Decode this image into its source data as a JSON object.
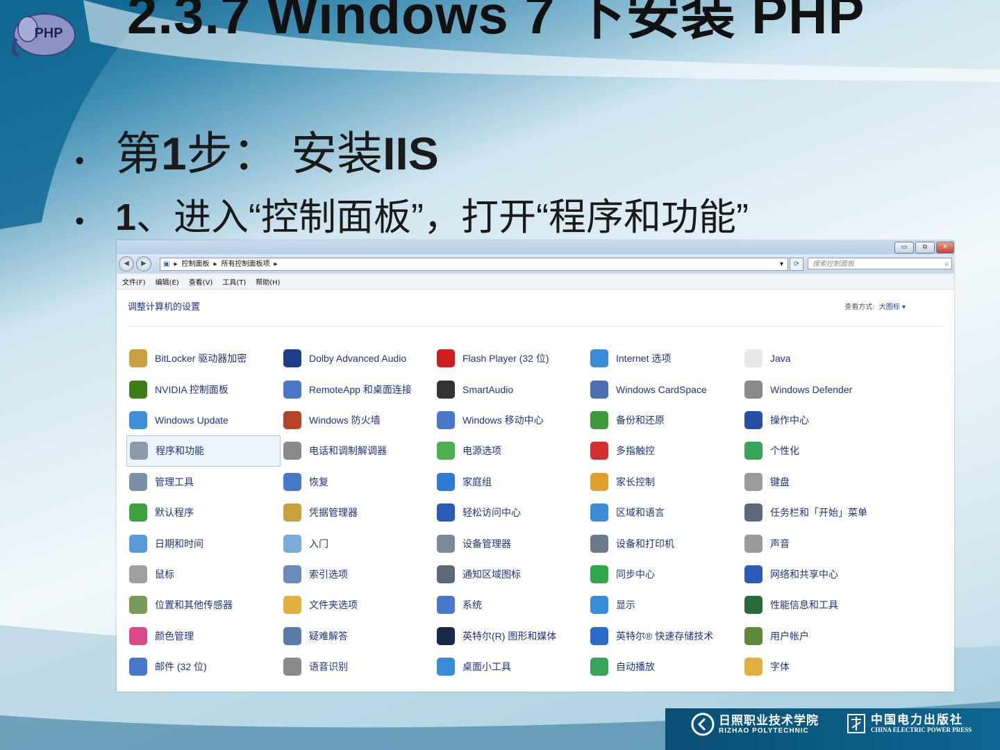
{
  "slide": {
    "title": "2.3.7 Windows 7 下安装 PHP",
    "bullet1_prefix": "第 ",
    "bullet1_num": "1",
    "bullet1_text": " 步：  安装 ",
    "bullet1_bold": "IIS",
    "bullet2_num": "1",
    "bullet2_text": " 、进入“控制面板”，打开“程序和功能”",
    "logo_text": "PHP"
  },
  "window": {
    "breadcrumb": [
      "控制面板",
      "所有控制面板项"
    ],
    "search_placeholder": "搜索控制面板",
    "menu": [
      "文件(F)",
      "编辑(E)",
      "查看(V)",
      "工具(T)",
      "帮助(H)"
    ],
    "heading": "调整计算机的设置",
    "view_by_label": "查看方式:",
    "view_by_value": "大图标 ▾",
    "items": [
      {
        "label": "BitLocker 驱动器加密",
        "icon": "bitlocker-icon",
        "color": "#c9a040"
      },
      {
        "label": "Dolby Advanced Audio",
        "icon": "dolby-icon",
        "color": "#1d3f8a"
      },
      {
        "label": "Flash Player (32 位)",
        "icon": "flash-icon",
        "color": "#d21d1d"
      },
      {
        "label": "Internet 选项",
        "icon": "internet-options-icon",
        "color": "#3a8cd8"
      },
      {
        "label": "Java",
        "icon": "java-icon",
        "color": "#e8e8e8"
      },
      {
        "label": "NVIDIA 控制面板",
        "icon": "nvidia-icon",
        "color": "#3c7d1a"
      },
      {
        "label": "RemoteApp 和桌面连接",
        "icon": "remoteapp-icon",
        "color": "#4a78c8"
      },
      {
        "label": "SmartAudio",
        "icon": "smartaudio-icon",
        "color": "#333333"
      },
      {
        "label": "Windows CardSpace",
        "icon": "cardspace-icon",
        "color": "#4a6fb0"
      },
      {
        "label": "Windows Defender",
        "icon": "defender-icon",
        "color": "#8a8a8a"
      },
      {
        "label": "Windows Update",
        "icon": "windows-update-icon",
        "color": "#3d8fd8"
      },
      {
        "label": "Windows 防火墙",
        "icon": "firewall-icon",
        "color": "#b5452a"
      },
      {
        "label": "Windows 移动中心",
        "icon": "mobility-center-icon",
        "color": "#4a78c8"
      },
      {
        "label": "备份和还原",
        "icon": "backup-icon",
        "color": "#3a9a3a"
      },
      {
        "label": "操作中心",
        "icon": "action-center-icon",
        "color": "#2a4ea8"
      },
      {
        "label": "程序和功能",
        "icon": "programs-features-icon",
        "color": "#8d9aa8"
      },
      {
        "label": "电话和调制解调器",
        "icon": "phone-modem-icon",
        "color": "#8a8a8a"
      },
      {
        "label": "电源选项",
        "icon": "power-options-icon",
        "color": "#4caf50"
      },
      {
        "label": "多指触控",
        "icon": "multitouch-icon",
        "color": "#d32f2f"
      },
      {
        "label": "个性化",
        "icon": "personalization-icon",
        "color": "#3aa35a"
      },
      {
        "label": "管理工具",
        "icon": "admin-tools-icon",
        "color": "#7a8fa8"
      },
      {
        "label": "恢复",
        "icon": "recovery-icon",
        "color": "#4a78c8"
      },
      {
        "label": "家庭组",
        "icon": "homegroup-icon",
        "color": "#2e7bd6"
      },
      {
        "label": "家长控制",
        "icon": "parental-controls-icon",
        "color": "#e0a030"
      },
      {
        "label": "键盘",
        "icon": "keyboard-icon",
        "color": "#9a9a9a"
      },
      {
        "label": "默认程序",
        "icon": "default-programs-icon",
        "color": "#3ca03c"
      },
      {
        "label": "凭据管理器",
        "icon": "credential-manager-icon",
        "color": "#c9a040"
      },
      {
        "label": "轻松访问中心",
        "icon": "ease-of-access-icon",
        "color": "#2a5bb8"
      },
      {
        "label": "区域和语言",
        "icon": "region-language-icon",
        "color": "#3a8cd8"
      },
      {
        "label": "任务栏和「开始」菜单",
        "icon": "taskbar-start-icon",
        "color": "#5a6a7a"
      },
      {
        "label": "日期和时间",
        "icon": "date-time-icon",
        "color": "#5a9ad8"
      },
      {
        "label": "入门",
        "icon": "getting-started-icon",
        "color": "#7aaad8"
      },
      {
        "label": "设备管理器",
        "icon": "device-manager-icon",
        "color": "#7a8a9a"
      },
      {
        "label": "设备和打印机",
        "icon": "devices-printers-icon",
        "color": "#6a7a8a"
      },
      {
        "label": "声音",
        "icon": "sound-icon",
        "color": "#9a9a9a"
      },
      {
        "label": "鼠标",
        "icon": "mouse-icon",
        "color": "#a0a0a0"
      },
      {
        "label": "索引选项",
        "icon": "indexing-icon",
        "color": "#6a8ab8"
      },
      {
        "label": "通知区域图标",
        "icon": "notification-area-icon",
        "color": "#5a6a7a"
      },
      {
        "label": "同步中心",
        "icon": "sync-center-icon",
        "color": "#2fa84a"
      },
      {
        "label": "网络和共享中心",
        "icon": "network-sharing-icon",
        "color": "#2a5bb8"
      },
      {
        "label": "位置和其他传感器",
        "icon": "location-sensors-icon",
        "color": "#7a9a5a"
      },
      {
        "label": "文件夹选项",
        "icon": "folder-options-icon",
        "color": "#e0b040"
      },
      {
        "label": "系统",
        "icon": "system-icon",
        "color": "#4a78c8"
      },
      {
        "label": "显示",
        "icon": "display-icon",
        "color": "#3a8cd8"
      },
      {
        "label": "性能信息和工具",
        "icon": "performance-icon",
        "color": "#2a6a3a"
      },
      {
        "label": "颜色管理",
        "icon": "color-management-icon",
        "color": "#d84a8a"
      },
      {
        "label": "疑难解答",
        "icon": "troubleshooting-icon",
        "color": "#5a7aa8"
      },
      {
        "label": "英特尔(R) 图形和媒体",
        "icon": "intel-graphics-icon",
        "color": "#1a2a4a"
      },
      {
        "label": "英特尔® 快速存储技术",
        "icon": "intel-storage-icon",
        "color": "#2a6ac8"
      },
      {
        "label": "用户帐户",
        "icon": "user-accounts-icon",
        "color": "#5a8a3a"
      },
      {
        "label": "邮件 (32 位)",
        "icon": "mail-icon",
        "color": "#4a78c8"
      },
      {
        "label": "语音识别",
        "icon": "speech-recognition-icon",
        "color": "#8a8a8a"
      },
      {
        "label": "桌面小工具",
        "icon": "desktop-gadgets-icon",
        "color": "#3a8cd8"
      },
      {
        "label": "自动播放",
        "icon": "autoplay-icon",
        "color": "#3aa35a"
      },
      {
        "label": "字体",
        "icon": "fonts-icon",
        "color": "#e0b040"
      }
    ],
    "selected_index": 15
  },
  "footer": {
    "school_cn": "日照职业技术学院",
    "school_en": "RIZHAO POLYTECHNIC",
    "press_cn": "中国电力出版社",
    "press_en": "CHINA ELECTRIC POWER PRESS"
  }
}
